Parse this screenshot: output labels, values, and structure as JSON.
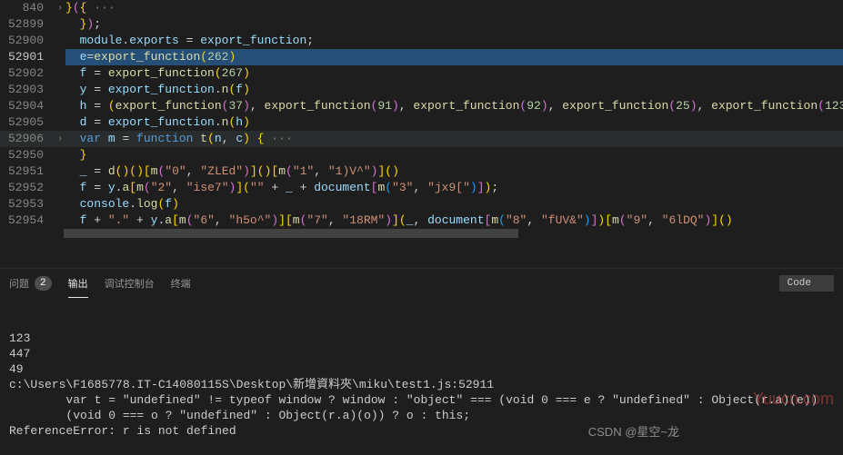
{
  "editor": {
    "lines": [
      {
        "num": "840",
        "active": false,
        "fold": ">",
        "tokens": [
          [
            "br",
            "}"
          ],
          [
            "br2",
            "("
          ],
          [
            "br",
            "{"
          ],
          [
            "pale",
            " ···"
          ]
        ]
      },
      {
        "num": "52899",
        "active": false,
        "fold": "",
        "tokens": [
          [
            "",
            "  "
          ],
          [
            "br",
            "}"
          ],
          [
            "br2",
            ")"
          ],
          [
            "",
            ";"
          ]
        ]
      },
      {
        "num": "52900",
        "active": false,
        "fold": "",
        "tokens": [
          [
            "",
            "  "
          ],
          [
            "var",
            "module"
          ],
          [
            "",
            "."
          ],
          [
            "var",
            "exports"
          ],
          [
            "",
            " = "
          ],
          [
            "var",
            "export_function"
          ],
          [
            "",
            ";"
          ]
        ]
      },
      {
        "num": "52901",
        "active": true,
        "fold": "",
        "sel": true,
        "tokens": [
          [
            "",
            "  "
          ],
          [
            "var",
            "e"
          ],
          [
            "",
            "="
          ],
          [
            "fn",
            "export_function"
          ],
          [
            "br",
            "("
          ],
          [
            "num",
            "262"
          ],
          [
            "br",
            ")"
          ]
        ]
      },
      {
        "num": "52902",
        "active": false,
        "fold": "",
        "tokens": [
          [
            "",
            "  "
          ],
          [
            "var",
            "f"
          ],
          [
            "",
            " = "
          ],
          [
            "fn",
            "export_function"
          ],
          [
            "br",
            "("
          ],
          [
            "num",
            "267"
          ],
          [
            "br",
            ")"
          ]
        ]
      },
      {
        "num": "52903",
        "active": false,
        "fold": "",
        "tokens": [
          [
            "",
            "  "
          ],
          [
            "var",
            "y"
          ],
          [
            "",
            " = "
          ],
          [
            "var",
            "export_function"
          ],
          [
            "",
            "."
          ],
          [
            "fn",
            "n"
          ],
          [
            "br",
            "("
          ],
          [
            "var",
            "f"
          ],
          [
            "br",
            ")"
          ]
        ]
      },
      {
        "num": "52904",
        "active": false,
        "fold": "",
        "tokens": [
          [
            "",
            "  "
          ],
          [
            "var",
            "h"
          ],
          [
            "",
            " = "
          ],
          [
            "br",
            "("
          ],
          [
            "fn",
            "export_function"
          ],
          [
            "br2",
            "("
          ],
          [
            "num",
            "37"
          ],
          [
            "br2",
            ")"
          ],
          [
            "",
            ", "
          ],
          [
            "fn",
            "export_function"
          ],
          [
            "br2",
            "("
          ],
          [
            "num",
            "91"
          ],
          [
            "br2",
            ")"
          ],
          [
            "",
            ", "
          ],
          [
            "fn",
            "export_function"
          ],
          [
            "br2",
            "("
          ],
          [
            "num",
            "92"
          ],
          [
            "br2",
            ")"
          ],
          [
            "",
            ", "
          ],
          [
            "fn",
            "export_function"
          ],
          [
            "br2",
            "("
          ],
          [
            "num",
            "25"
          ],
          [
            "br2",
            ")"
          ],
          [
            "",
            ", "
          ],
          [
            "fn",
            "export_function"
          ],
          [
            "br2",
            "("
          ],
          [
            "num",
            "123"
          ],
          [
            "br2",
            ")"
          ],
          [
            "",
            ", "
          ]
        ]
      },
      {
        "num": "52905",
        "active": false,
        "fold": "",
        "tokens": [
          [
            "",
            "  "
          ],
          [
            "var",
            "d"
          ],
          [
            "",
            " = "
          ],
          [
            "var",
            "export_function"
          ],
          [
            "",
            "."
          ],
          [
            "fn",
            "n"
          ],
          [
            "br",
            "("
          ],
          [
            "var",
            "h"
          ],
          [
            "br",
            ")"
          ]
        ]
      },
      {
        "num": "52906",
        "active": false,
        "fold": ">",
        "hl": true,
        "tokens": [
          [
            "",
            "  "
          ],
          [
            "kw",
            "var"
          ],
          [
            "",
            " "
          ],
          [
            "var",
            "m"
          ],
          [
            "",
            " = "
          ],
          [
            "kw",
            "function"
          ],
          [
            "",
            " "
          ],
          [
            "fn",
            "t"
          ],
          [
            "br",
            "("
          ],
          [
            "var",
            "n"
          ],
          [
            "",
            ", "
          ],
          [
            "var",
            "c"
          ],
          [
            "br",
            ")"
          ],
          [
            "",
            " "
          ],
          [
            "br",
            "{"
          ],
          [
            "pale",
            " ···"
          ]
        ]
      },
      {
        "num": "52950",
        "active": false,
        "fold": "",
        "tokens": [
          [
            "",
            "  "
          ],
          [
            "br",
            "}"
          ]
        ]
      },
      {
        "num": "52951",
        "active": false,
        "fold": "",
        "tokens": [
          [
            "",
            "  "
          ],
          [
            "var",
            "_"
          ],
          [
            "",
            " = "
          ],
          [
            "fn",
            "d"
          ],
          [
            "br",
            "("
          ],
          [
            "br",
            ")"
          ],
          [
            "br",
            "("
          ],
          [
            "br",
            ")"
          ],
          [
            "br",
            "["
          ],
          [
            "fn",
            "m"
          ],
          [
            "br2",
            "("
          ],
          [
            "str",
            "\"0\""
          ],
          [
            "",
            ", "
          ],
          [
            "str",
            "\"ZLEd\""
          ],
          [
            "br2",
            ")"
          ],
          [
            "br",
            "]"
          ],
          [
            "br",
            "("
          ],
          [
            "br",
            ")"
          ],
          [
            "br",
            "["
          ],
          [
            "fn",
            "m"
          ],
          [
            "br2",
            "("
          ],
          [
            "str",
            "\"1\""
          ],
          [
            "",
            ", "
          ],
          [
            "str",
            "\"1)V^\""
          ],
          [
            "br2",
            ")"
          ],
          [
            "br",
            "]"
          ],
          [
            "br",
            "("
          ],
          [
            "br",
            ")"
          ]
        ]
      },
      {
        "num": "52952",
        "active": false,
        "fold": "",
        "tokens": [
          [
            "",
            "  "
          ],
          [
            "var",
            "f"
          ],
          [
            "",
            " = "
          ],
          [
            "var",
            "y"
          ],
          [
            "",
            "."
          ],
          [
            "fn",
            "a"
          ],
          [
            "br",
            "["
          ],
          [
            "fn",
            "m"
          ],
          [
            "br2",
            "("
          ],
          [
            "str",
            "\"2\""
          ],
          [
            "",
            ", "
          ],
          [
            "str",
            "\"ise7\""
          ],
          [
            "br2",
            ")"
          ],
          [
            "br",
            "]"
          ],
          [
            "br",
            "("
          ],
          [
            "str",
            "\"\""
          ],
          [
            "",
            " + "
          ],
          [
            "var",
            "_"
          ],
          [
            "",
            " + "
          ],
          [
            "var",
            "document"
          ],
          [
            "br2",
            "["
          ],
          [
            "fn",
            "m"
          ],
          [
            "br3",
            "("
          ],
          [
            "str",
            "\"3\""
          ],
          [
            "",
            ", "
          ],
          [
            "str",
            "\"jx9[\""
          ],
          [
            "br3",
            ")"
          ],
          [
            "br2",
            "]"
          ],
          [
            "br",
            ")"
          ],
          [
            "",
            ";"
          ]
        ]
      },
      {
        "num": "52953",
        "active": false,
        "fold": "",
        "tokens": [
          [
            "",
            "  "
          ],
          [
            "var",
            "console"
          ],
          [
            "",
            "."
          ],
          [
            "fn",
            "log"
          ],
          [
            "br",
            "("
          ],
          [
            "var",
            "f"
          ],
          [
            "br",
            ")"
          ]
        ]
      },
      {
        "num": "52954",
        "active": false,
        "fold": "",
        "tokens": [
          [
            "",
            "  "
          ],
          [
            "var",
            "f"
          ],
          [
            "",
            " + "
          ],
          [
            "str",
            "\".\""
          ],
          [
            "",
            " + "
          ],
          [
            "var",
            "y"
          ],
          [
            "",
            "."
          ],
          [
            "fn",
            "a"
          ],
          [
            "br",
            "["
          ],
          [
            "fn",
            "m"
          ],
          [
            "br2",
            "("
          ],
          [
            "str",
            "\"6\""
          ],
          [
            "",
            ", "
          ],
          [
            "str",
            "\"h5o^\""
          ],
          [
            "br2",
            ")"
          ],
          [
            "br",
            "]"
          ],
          [
            "br",
            "["
          ],
          [
            "fn",
            "m"
          ],
          [
            "br2",
            "("
          ],
          [
            "str",
            "\"7\""
          ],
          [
            "",
            ", "
          ],
          [
            "str",
            "\"18RM\""
          ],
          [
            "br2",
            ")"
          ],
          [
            "br",
            "]"
          ],
          [
            "br",
            "("
          ],
          [
            "var",
            "_"
          ],
          [
            "",
            ", "
          ],
          [
            "var",
            "document"
          ],
          [
            "br2",
            "["
          ],
          [
            "fn",
            "m"
          ],
          [
            "br3",
            "("
          ],
          [
            "str",
            "\"8\""
          ],
          [
            "",
            ", "
          ],
          [
            "str",
            "\"fUV&\""
          ],
          [
            "br3",
            ")"
          ],
          [
            "br2",
            "]"
          ],
          [
            "br",
            ")"
          ],
          [
            "br",
            "["
          ],
          [
            "fn",
            "m"
          ],
          [
            "br2",
            "("
          ],
          [
            "str",
            "\"9\""
          ],
          [
            "",
            ", "
          ],
          [
            "str",
            "\"6lDQ\""
          ],
          [
            "br2",
            ")"
          ],
          [
            "br",
            "]"
          ],
          [
            "br",
            "("
          ],
          [
            "br",
            ")"
          ]
        ]
      }
    ]
  },
  "panel": {
    "tabs": [
      {
        "label": "问题",
        "badge": "2",
        "active": false
      },
      {
        "label": "输出",
        "active": true
      },
      {
        "label": "调试控制台",
        "active": false
      },
      {
        "label": "终端",
        "active": false
      }
    ],
    "dropdown": "Code"
  },
  "output": {
    "lines": [
      "123",
      "447",
      "49",
      "c:\\Users\\F1685778.IT-C14080115S\\Desktop\\新增資料夾\\miku\\test1.js:52911",
      "        var t = \"undefined\" != typeof window ? window : \"object\" === (void 0 === e ? \"undefined\" : Object(r.a)(e))",
      "        (void 0 === o ? \"undefined\" : Object(r.a)(o)) ? o : this;",
      "",
      "",
      "ReferenceError: r is not defined"
    ]
  },
  "watermark1": "Yuucn.com",
  "watermark2": "CSDN @星空~龙"
}
